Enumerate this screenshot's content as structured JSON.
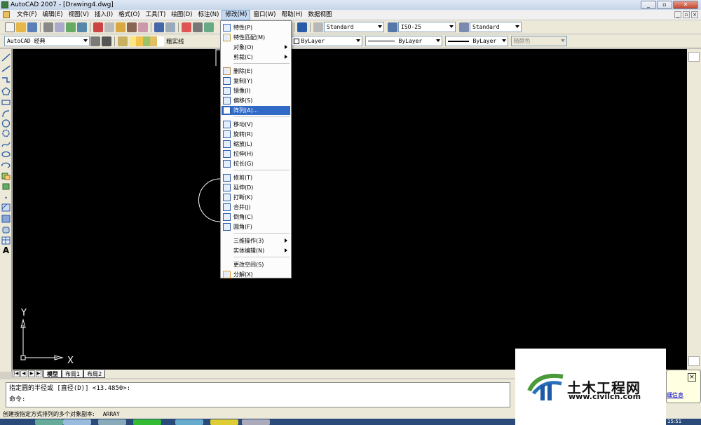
{
  "window": {
    "title": "AutoCAD 2007 - [Drawing4.dwg]"
  },
  "menubar": [
    "文件(F)",
    "编辑(E)",
    "视图(V)",
    "插入(I)",
    "格式(O)",
    "工具(T)",
    "绘图(D)",
    "标注(N)",
    "修改(M)",
    "窗口(W)",
    "帮助(H)",
    "数据视图"
  ],
  "active_menu": "修改(M)",
  "toolbar1": {
    "text_style": "Standard",
    "dim_style": "ISO-25",
    "table_style": "Standard"
  },
  "toolbar2": {
    "workspace": "AutoCAD 经典",
    "linetype_label": "粗实线",
    "layer": "ByLayer",
    "linetype": "ByLayer",
    "lineweight": "ByLayer",
    "plot_style": "随颜色"
  },
  "modify_menu": {
    "items": [
      {
        "label": "特性(P)",
        "icon": "properties-icon"
      },
      {
        "label": "特性匹配(M)",
        "icon": "match-properties-icon"
      },
      {
        "label": "对象(O)",
        "submenu": true
      },
      {
        "label": "剪裁(C)",
        "submenu": true
      },
      {
        "label": "删除(E)",
        "icon": "erase-icon"
      },
      {
        "label": "复制(Y)",
        "icon": "copy-icon"
      },
      {
        "label": "镜像(I)",
        "icon": "mirror-icon"
      },
      {
        "label": "偏移(S)",
        "icon": "offset-icon"
      },
      {
        "label": "阵列(A)...",
        "icon": "array-icon",
        "highlighted": true
      },
      {
        "label": "移动(V)",
        "icon": "move-icon"
      },
      {
        "label": "旋转(R)",
        "icon": "rotate-icon"
      },
      {
        "label": "缩放(L)",
        "icon": "scale-icon"
      },
      {
        "label": "拉伸(H)",
        "icon": "stretch-icon"
      },
      {
        "label": "拉长(G)",
        "icon": "lengthen-icon"
      },
      {
        "label": "修剪(T)",
        "icon": "trim-icon"
      },
      {
        "label": "延伸(D)",
        "icon": "extend-icon"
      },
      {
        "label": "打断(K)",
        "icon": "break-icon"
      },
      {
        "label": "合并(J)",
        "icon": "join-icon"
      },
      {
        "label": "倒角(C)",
        "icon": "chamfer-icon"
      },
      {
        "label": "圆角(F)",
        "icon": "fillet-icon"
      },
      {
        "label": "三维操作(3)",
        "submenu": true
      },
      {
        "label": "实体编辑(N)",
        "submenu": true
      },
      {
        "label": "更改空间(S)"
      },
      {
        "label": "分解(X)",
        "icon": "explode-icon"
      }
    ]
  },
  "ucs": {
    "x": "X",
    "y": "Y"
  },
  "tabs": [
    "模型",
    "布局1",
    "布局2"
  ],
  "command": {
    "line1": "指定圆的半径或 [直径(D)] <13.4850>:",
    "line2": "命令:"
  },
  "status": {
    "text": "创建按指定方式排列的多个对象副本:",
    "command": "ARRAY",
    "clock": "15:51"
  },
  "watermark": {
    "name": "土木工程网",
    "url": "www.civilcn.com"
  },
  "balloon": {
    "link": "细信息"
  }
}
